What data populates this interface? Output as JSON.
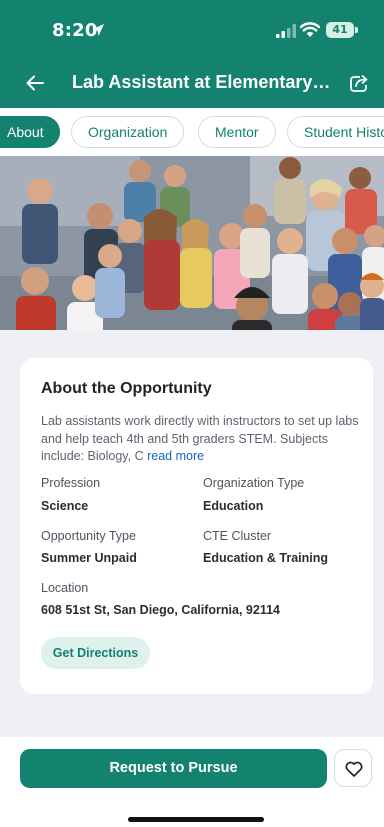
{
  "status_bar": {
    "time": "8:20",
    "battery": "41"
  },
  "header": {
    "title": "Lab Assistant at Elementary In..."
  },
  "tabs": [
    {
      "label": "About",
      "active": true
    },
    {
      "label": "Organization",
      "active": false
    },
    {
      "label": "Mentor",
      "active": false
    },
    {
      "label": "Student History",
      "active": false
    }
  ],
  "hero": {
    "alt": "Group photo of elementary students and instructors"
  },
  "about": {
    "title": "About the Opportunity",
    "description": "Lab assistants work directly with instructors to set up labs and help teach 4th and 5th graders STEM. Subjects include: Biology, C",
    "read_more": "read more",
    "profession_label": "Profession",
    "profession_value": "Science",
    "org_type_label": "Organization Type",
    "org_type_value": "Education",
    "opp_type_label": "Opportunity Type",
    "opp_type_value": "Summer Unpaid",
    "cte_label": "CTE Cluster",
    "cte_value": "Education & Training",
    "location_label": "Location",
    "location_value": "608 51st St, San Diego, California, 92114",
    "directions_label": "Get Directions"
  },
  "footer": {
    "pursue_label": "Request to Pursue"
  },
  "colors": {
    "brand": "#13826e",
    "link": "#1565c0",
    "chip_bg": "#dff1ec"
  },
  "icons": {
    "back": "arrow-left-icon",
    "share": "share-icon",
    "location": "location-arrow-icon",
    "signal": "cell-signal-icon",
    "wifi": "wifi-icon",
    "favorite": "heart-icon"
  }
}
